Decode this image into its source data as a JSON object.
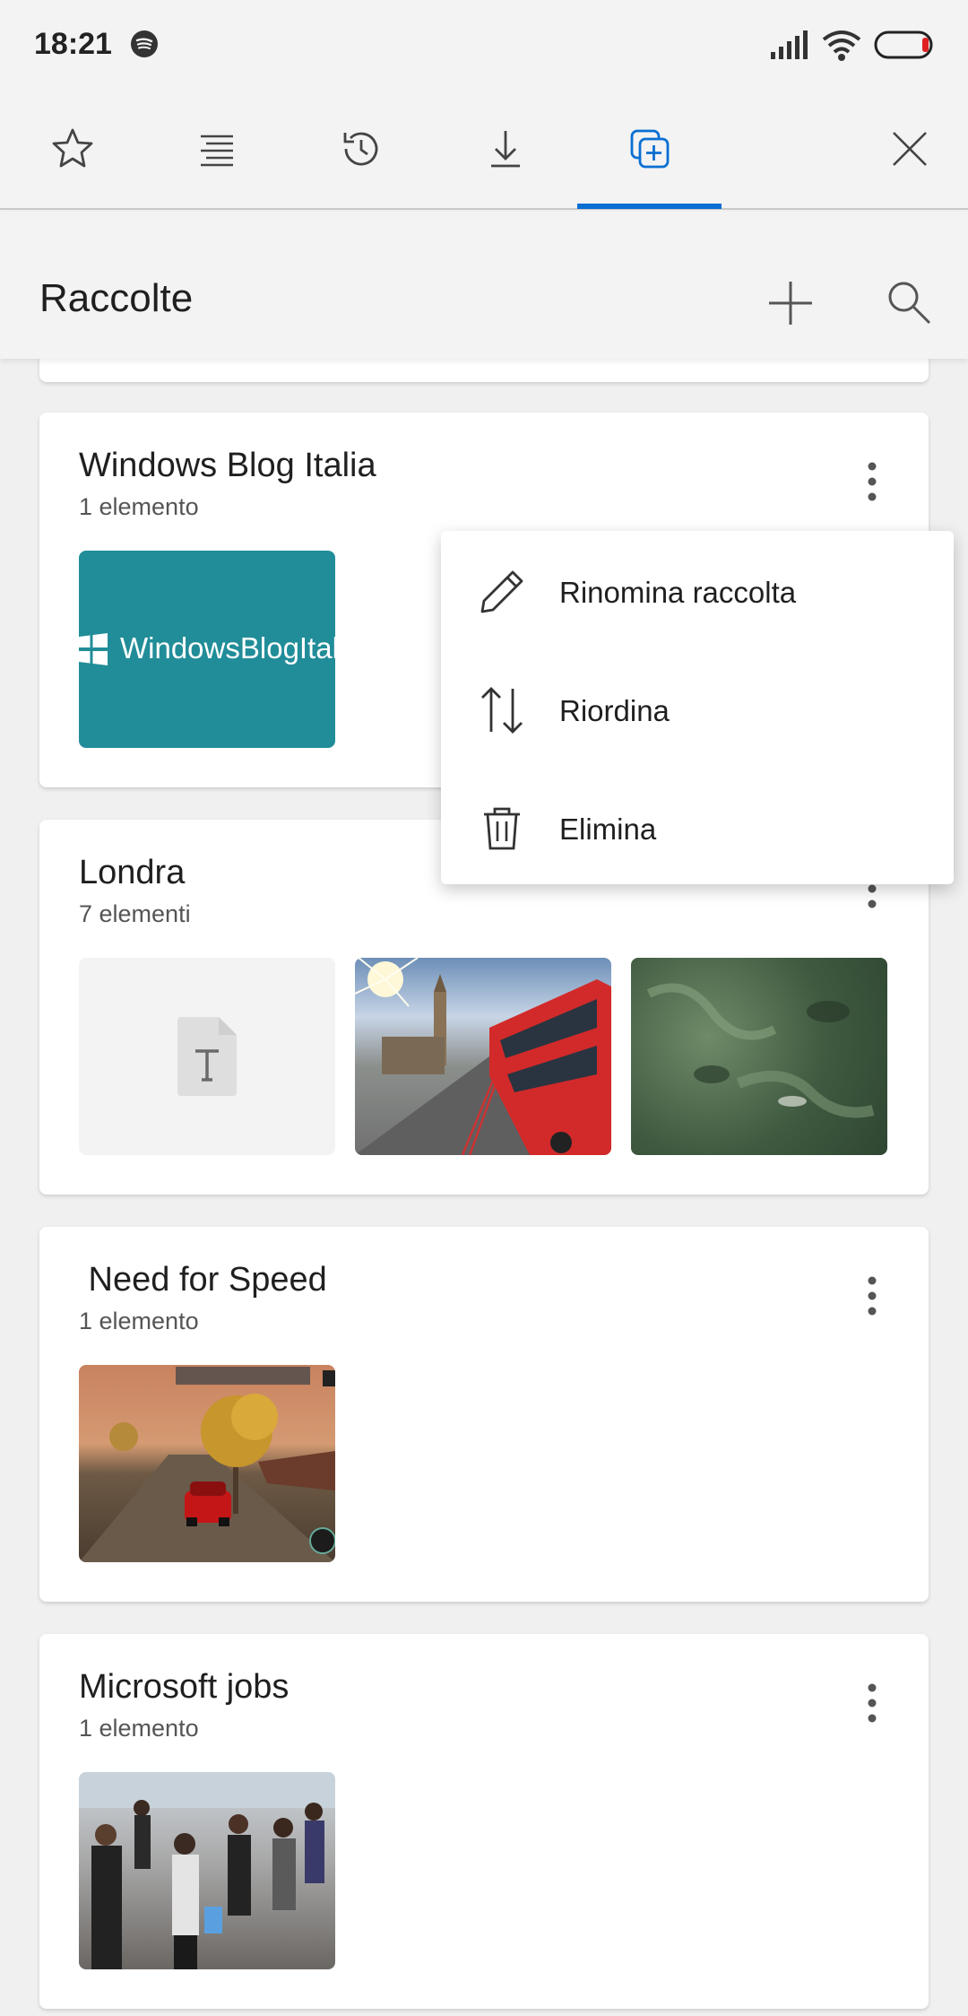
{
  "status_bar": {
    "time": "18:21"
  },
  "tabs": [
    {
      "icon": "star-icon",
      "active": false
    },
    {
      "icon": "reading-list-icon",
      "active": false
    },
    {
      "icon": "history-icon",
      "active": false
    },
    {
      "icon": "download-icon",
      "active": false
    },
    {
      "icon": "collections-icon",
      "active": true
    },
    {
      "icon": "close-icon",
      "active": false
    }
  ],
  "header": {
    "title": "Raccolte"
  },
  "collections": [
    {
      "title": "Windows Blog Italia",
      "count": "1 elemento",
      "thumb_text": "WindowsBlogItalia"
    },
    {
      "title": "Londra",
      "count": "7 elementi"
    },
    {
      "title": " Need for Speed",
      "count": "1 elemento"
    },
    {
      "title": "Microsoft jobs",
      "count": "1 elemento"
    }
  ],
  "context_menu": {
    "items": [
      {
        "label": "Rinomina raccolta",
        "icon": "pencil-icon"
      },
      {
        "label": "Riordina",
        "icon": "reorder-icon"
      },
      {
        "label": "Elimina",
        "icon": "trash-icon"
      }
    ]
  },
  "colors": {
    "accent": "#0a6fd2",
    "wbi_teal": "#218d99"
  }
}
